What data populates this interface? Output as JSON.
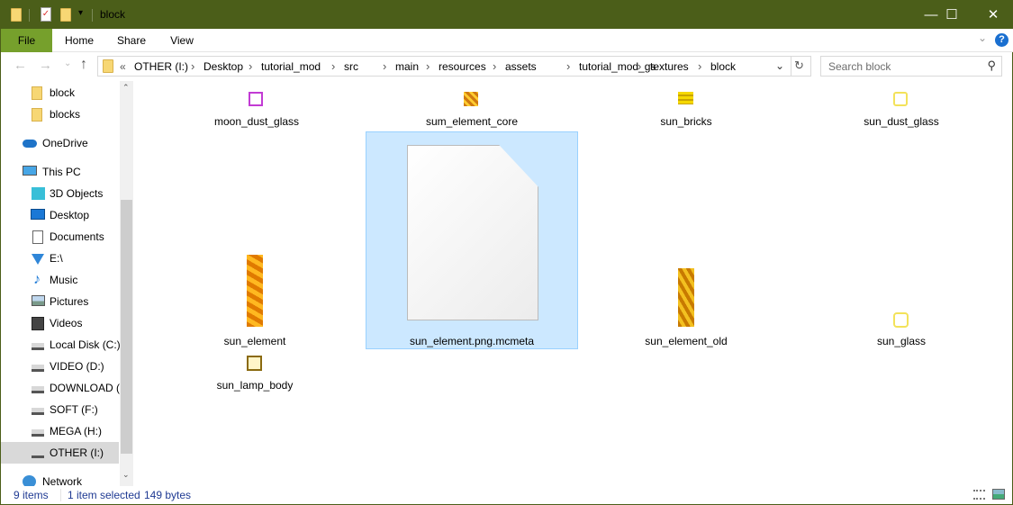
{
  "window": {
    "title": "block",
    "minimize": "—",
    "maximize": "☐",
    "close": "✕",
    "accent": "#4b5e19"
  },
  "ribbon": {
    "tabs": [
      "File",
      "Home",
      "Share",
      "View"
    ],
    "expand": "⌄",
    "help": "?"
  },
  "nav": {
    "back": "←",
    "forward": "→",
    "recent": "⌄",
    "up": "↑",
    "overflow": "«",
    "breadcrumb": [
      "OTHER (I:)",
      "Desktop",
      "tutorial_mod",
      "src",
      "main",
      "resources",
      "assets",
      "tutorial_mod_gs",
      "textures",
      "block"
    ],
    "dropdown": "⌄",
    "refresh": "↻"
  },
  "search": {
    "placeholder": "Search block",
    "icon": "search-icon"
  },
  "sidebar": {
    "items": [
      {
        "label": "block",
        "icon": "folder-icon"
      },
      {
        "label": "blocks",
        "icon": "folder-icon"
      },
      {
        "label": "OneDrive",
        "icon": "cloud-icon"
      },
      {
        "label": "This PC",
        "icon": "computer-icon"
      },
      {
        "label": "3D Objects",
        "icon": "cube-icon"
      },
      {
        "label": "Desktop",
        "icon": "desktop-icon"
      },
      {
        "label": "Documents",
        "icon": "document-icon"
      },
      {
        "label": "E:\\",
        "icon": "download-icon"
      },
      {
        "label": "Music",
        "icon": "music-icon"
      },
      {
        "label": "Pictures",
        "icon": "pictures-icon"
      },
      {
        "label": "Videos",
        "icon": "videos-icon"
      },
      {
        "label": "Local Disk (C:)",
        "icon": "drive-icon"
      },
      {
        "label": "VIDEO (D:)",
        "icon": "drive-icon"
      },
      {
        "label": "DOWNLOAD (E:)",
        "icon": "drive-icon"
      },
      {
        "label": "SOFT (F:)",
        "icon": "drive-icon"
      },
      {
        "label": "MEGA (H:)",
        "icon": "drive-icon"
      },
      {
        "label": "OTHER (I:)",
        "icon": "drive-icon",
        "selected": true
      },
      {
        "label": "Network",
        "icon": "network-icon"
      }
    ]
  },
  "files": [
    {
      "name": "moon_dust_glass"
    },
    {
      "name": "sum_element_core"
    },
    {
      "name": "sun_bricks"
    },
    {
      "name": "sun_dust_glass"
    },
    {
      "name": "sun_element"
    },
    {
      "name": "sun_element.png.mcmeta",
      "selected": true
    },
    {
      "name": "sun_element_old"
    },
    {
      "name": "sun_glass"
    },
    {
      "name": "sun_lamp_body"
    }
  ],
  "status": {
    "count": "9 items",
    "selection": "1 item selected",
    "size": "149 bytes"
  }
}
